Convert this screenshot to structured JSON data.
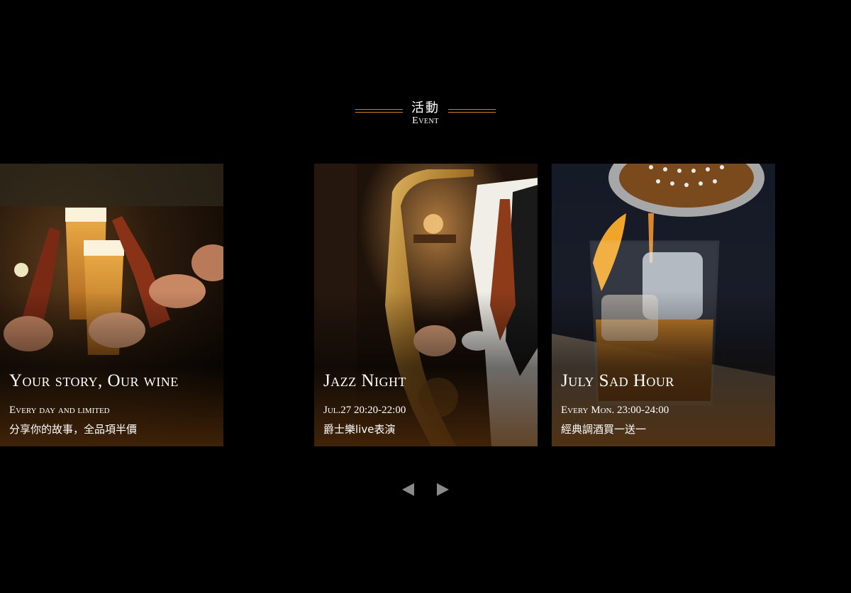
{
  "section": {
    "title_zh": "活動",
    "title_en": "Event",
    "accent_color": "#d07a2c"
  },
  "events": [
    {
      "title": "Jazz Night",
      "time": "Jul.27 20:20-22:00",
      "description": "爵士樂live表演",
      "image": "saxophone-player-photo"
    },
    {
      "title": "July Sad Hour",
      "time": "Every Mon. 23:00-24:00",
      "description": "經典調酒買一送一",
      "image": "whiskey-cocktail-photo"
    },
    {
      "title": "Your story, Our wine",
      "time": "Every day and limited",
      "description": "分享你的故事，全品項半價",
      "image": "beer-cheers-photo"
    }
  ],
  "carousel": {
    "prev_icon": "triangle-left-icon",
    "next_icon": "triangle-right-icon"
  }
}
